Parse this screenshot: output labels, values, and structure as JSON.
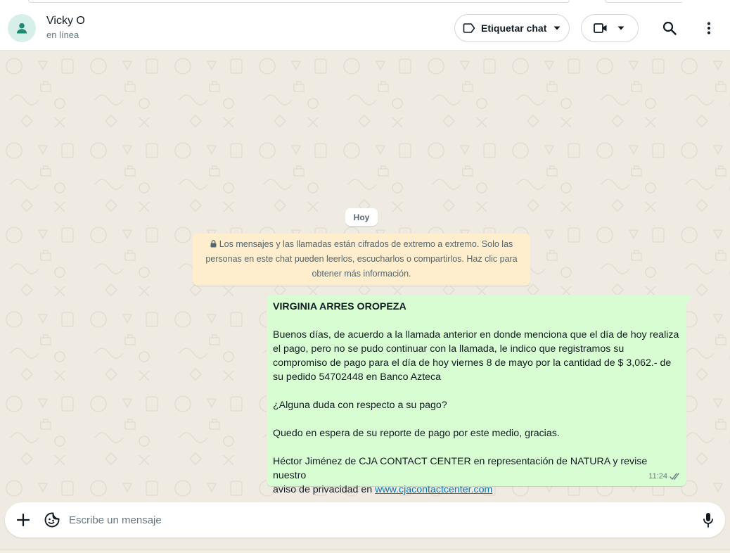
{
  "header": {
    "contact_name": "Vicky O",
    "contact_status": "en línea",
    "label_button": "Etiquetar chat"
  },
  "chat": {
    "date_chip": "Hoy",
    "encryption_notice": {
      "line1": "Los mensajes y las llamadas están cifrados de extremo a extremo. Solo las",
      "line2": "personas en este chat pueden leerlos, escucharlos o compartirlos. Haz clic para",
      "line3": "obtener más información."
    },
    "message": {
      "sender_line": "VIRGINIA ARRES OROPEZA",
      "paragraph1": "Buenos días, de acuerdo a la llamada anterior en donde menciona que el día de hoy realiza\nel pago, pero no se pudo continuar con la llamada, le indico que registramos su\ncompromiso de pago para el día de hoy viernes 8 de mayo por la cantidad de $ 3,062.- de\nsu pedido 54702448 en Banco Azteca",
      "paragraph2": "¿Alguna duda con respecto a su pago?",
      "paragraph3": "Quedo en espera de su reporte de pago por este medio, gracias.",
      "paragraph4": "Héctor Jiménez de CJA CONTACT CENTER en representación de NATURA y revise nuestro\naviso de privacidad en ",
      "link": "www.cjacontactcenter.com",
      "time": "11:24",
      "status": "read"
    }
  },
  "composer": {
    "placeholder": "Escribe un mensaje",
    "value": ""
  },
  "colors": {
    "outgoing_bubble": "#d9fdd3",
    "notice_bg": "#ffeecd",
    "chat_bg": "#efeae2",
    "link": "#027eb5",
    "read_tick": "#667781"
  }
}
